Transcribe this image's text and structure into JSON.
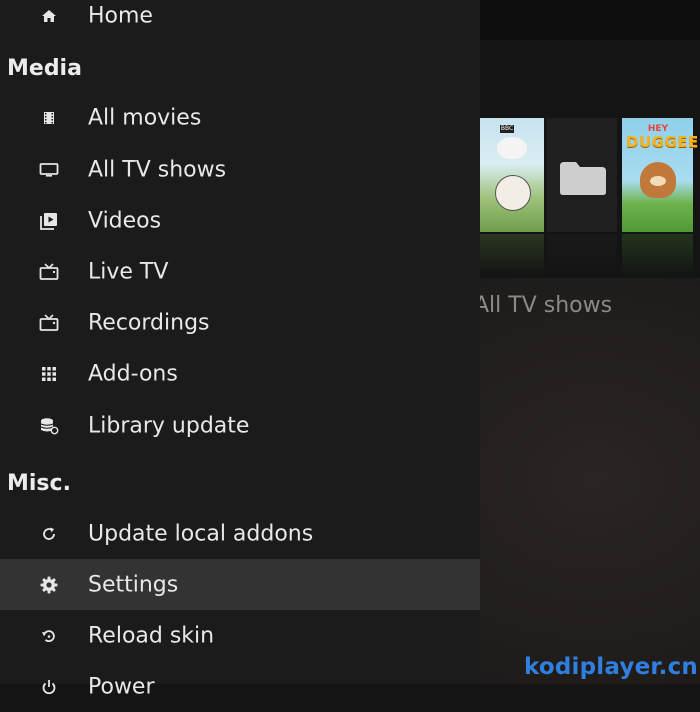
{
  "menu": {
    "items_top": [
      {
        "label": "Home",
        "icon": "home-icon"
      }
    ],
    "sections": [
      {
        "title": "Media",
        "items": [
          {
            "label": "All movies",
            "icon": "film-icon"
          },
          {
            "label": "All TV shows",
            "icon": "tv-icon"
          },
          {
            "label": "Videos",
            "icon": "video-library-icon"
          },
          {
            "label": "Live TV",
            "icon": "live-tv-icon"
          },
          {
            "label": "Recordings",
            "icon": "recordings-icon"
          },
          {
            "label": "Add-ons",
            "icon": "addons-grid-icon"
          },
          {
            "label": "Library update",
            "icon": "library-update-icon"
          }
        ]
      },
      {
        "title": "Misc.",
        "items": [
          {
            "label": "Update local addons",
            "icon": "refresh-icon"
          },
          {
            "label": "Settings",
            "icon": "gear-icon",
            "focused": true
          },
          {
            "label": "Reload skin",
            "icon": "reload-icon"
          },
          {
            "label": "Power",
            "icon": "power-icon"
          }
        ]
      }
    ]
  },
  "background": {
    "section_label": "All TV shows",
    "thumbnails": [
      {
        "name": "sarah-and-duck",
        "badge": "BBC"
      },
      {
        "name": "folder"
      },
      {
        "name": "hey-duggee",
        "title_line1": "HEY",
        "title_line2": "DUGGEE"
      }
    ]
  },
  "watermark": "kodiplayer.cn",
  "colors": {
    "menu_bg": "#1b1b1b",
    "focused_bg": "#333333",
    "text": "#e8e8e8",
    "watermark": "#2f7fe0"
  }
}
